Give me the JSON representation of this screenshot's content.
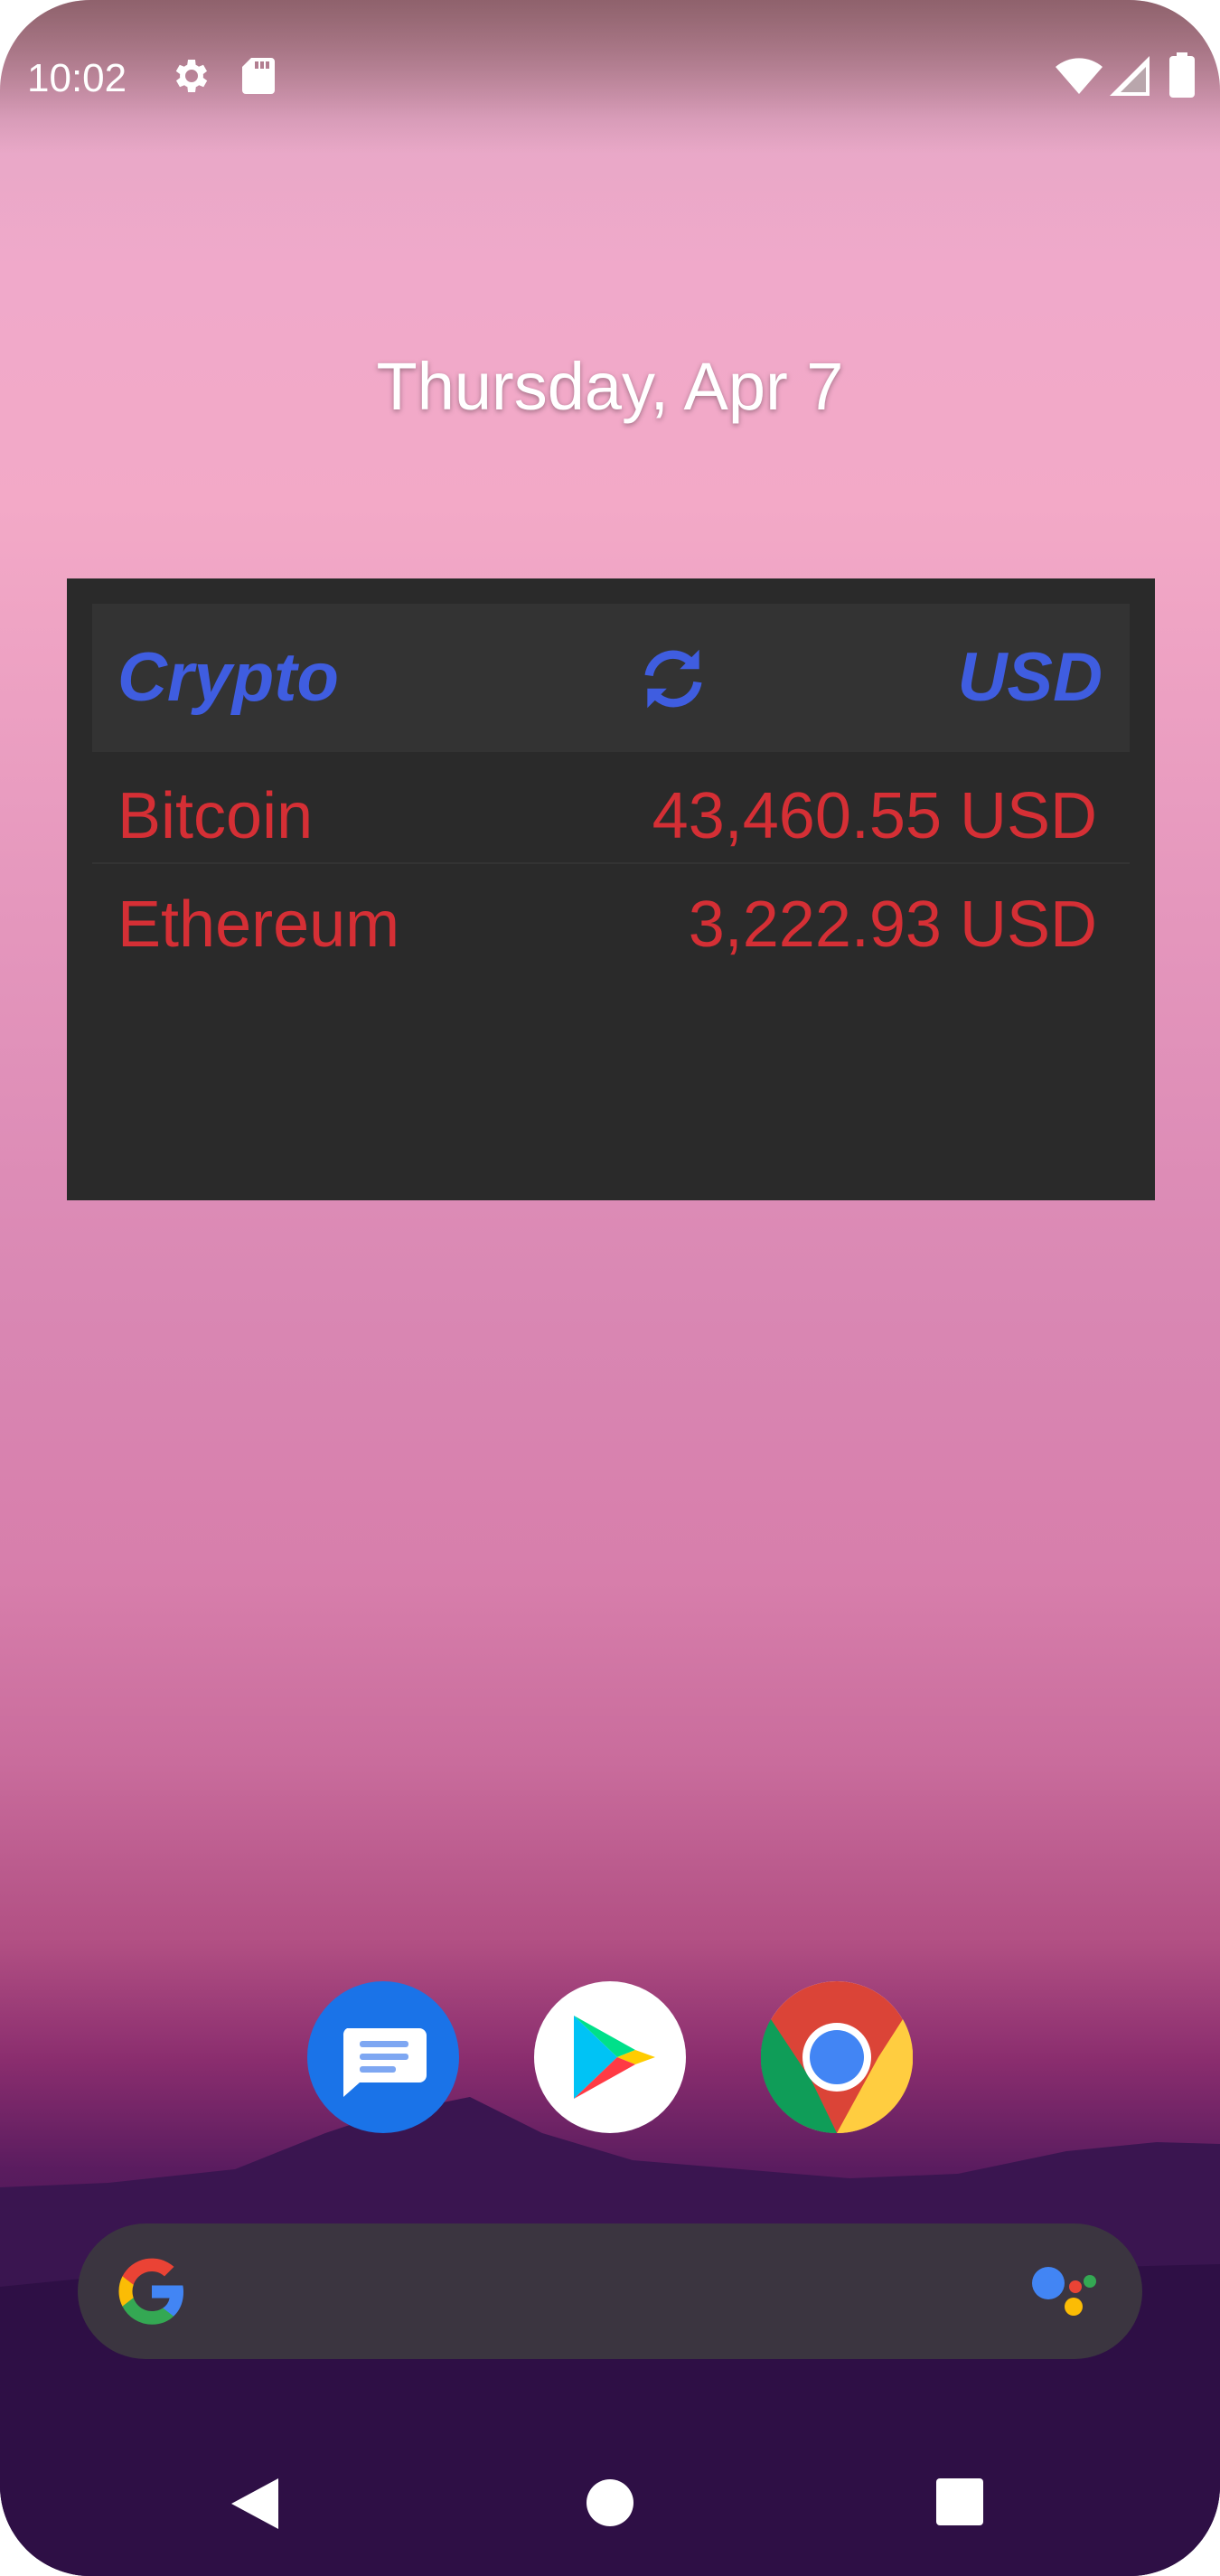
{
  "status": {
    "time": "10:02",
    "icons": [
      "settings-icon",
      "sd-card-icon",
      "wifi-icon",
      "signal-icon",
      "battery-icon"
    ]
  },
  "lockscreen": {
    "date": "Thursday, Apr 7"
  },
  "widget": {
    "header_left": "Crypto",
    "header_right": "USD",
    "accent_color": "#3f5de0",
    "value_color": "#d52f35",
    "rows": [
      {
        "name": "Bitcoin",
        "price": "43,460.55 USD"
      },
      {
        "name": "Ethereum",
        "price": "3,222.93 USD"
      }
    ]
  },
  "dock": {
    "apps": [
      "messages-app-icon",
      "play-store-app-icon",
      "chrome-app-icon"
    ]
  },
  "search": {
    "icons": [
      "google-g-icon",
      "assistant-icon"
    ]
  },
  "nav": {
    "buttons": [
      "back-icon",
      "home-icon",
      "recents-icon"
    ]
  }
}
